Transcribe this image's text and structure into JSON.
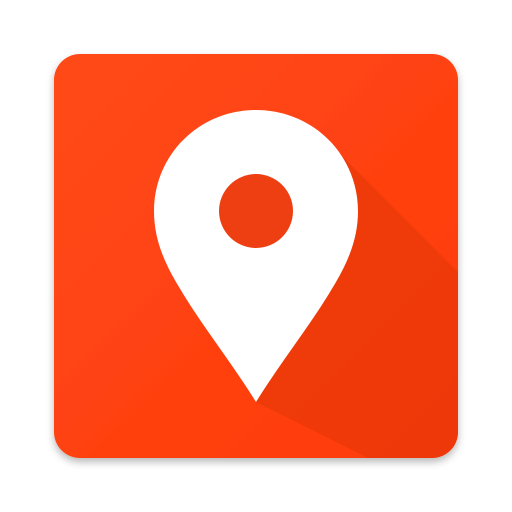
{
  "icon": {
    "name": "map-pin-icon",
    "tile_color": "#FF4013",
    "tile_shadow_color": "#E53A10",
    "long_shadow_color": "#EA3A0E",
    "pin_color": "#FFFFFF",
    "pin_hole_color": "#EE3F12"
  }
}
